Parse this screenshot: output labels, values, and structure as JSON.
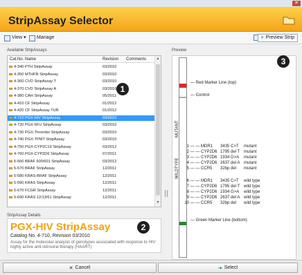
{
  "app": {
    "title": "StripAssay Selector"
  },
  "toolbar": {
    "view_label": "View",
    "manage_label": "Manage",
    "preview_strip_label": "Preview Strip"
  },
  "sections": {
    "available_label": "Available StripAssays",
    "preview_label": "Preview",
    "details_label": "StripAssay Details"
  },
  "list": {
    "columns": [
      "Cat.No.",
      "Name",
      "Revision",
      "Comments"
    ],
    "rows": [
      {
        "cat": "4-340",
        "name": "PTH StripAssay",
        "rev": "03/2010"
      },
      {
        "cat": "4-350",
        "name": "MTHFR StripAssay",
        "rev": "03/2010"
      },
      {
        "cat": "4-360",
        "name": "CVD StripAssay T",
        "rev": "03/2010"
      },
      {
        "cat": "4-370",
        "name": "CVD StripAssay A",
        "rev": "03/2010"
      },
      {
        "cat": "4-380",
        "name": "CAH StripAssay",
        "rev": "05/2011"
      },
      {
        "cat": "4-410",
        "name": "CF StripAssay",
        "rev": "01/2012"
      },
      {
        "cat": "4-420",
        "name": "CF StripAssay TUR",
        "rev": "01/2012"
      },
      {
        "cat": "4-710",
        "name": "PGX-HIV StripAssay",
        "rev": "03/2010"
      },
      {
        "cat": "4-720",
        "name": "PGX-5FU StripAssay",
        "rev": "03/2010"
      },
      {
        "cat": "4-730",
        "name": "PGX-Thrombo StripAssay",
        "rev": "03/2010"
      },
      {
        "cat": "4-740",
        "name": "PGX-TPMT StripAssay",
        "rev": "03/2010"
      },
      {
        "cat": "4-750",
        "name": "PGX-CYP2C19 StripAssay",
        "rev": "03/2012"
      },
      {
        "cat": "4-760",
        "name": "PGX-CYP2D6 StripAssay",
        "rev": "07/2011"
      },
      {
        "cat": "5-560",
        "name": "BRAF 600/601 StripAssay",
        "rev": "03/2012"
      },
      {
        "cat": "5-570",
        "name": "BRAF StripAssay",
        "rev": "12/2011"
      },
      {
        "cat": "5-580",
        "name": "KRAS-BRAF StripAssay",
        "rev": "12/2011"
      },
      {
        "cat": "5-590",
        "name": "KRAS StripAssay",
        "rev": "12/2011"
      },
      {
        "cat": "5-670",
        "name": "FCGR StripAssay",
        "rev": "12/2011"
      },
      {
        "cat": "5-690",
        "name": "KRAS 12/13/61 StripAssay",
        "rev": "12/2011"
      }
    ],
    "selected_index": 7
  },
  "badges": {
    "one": "1",
    "two": "2",
    "three": "3"
  },
  "details": {
    "title": "PGX-HIV StripAssay",
    "catalog": "Catalog No. 4-710, Revision 03/2010",
    "description": "Assay for the molecular analysis of genotypes associated with response to HIV highly active anti-retroviral therapy (HAART)"
  },
  "preview": {
    "red_marker": "Red Marker Line (top)",
    "control": "Control",
    "green_marker": "Green Marker Line (bottom)",
    "mutant_label": "MUTANT",
    "wildtype_label": "WILDTYPE",
    "mutant_rows": [
      {
        "n": "1",
        "gene": "MDR1",
        "variant": "3435 C>T",
        "type": "mutant"
      },
      {
        "n": "2",
        "gene": "CYP2D6",
        "variant": "1795 del T",
        "type": "mutant"
      },
      {
        "n": "3",
        "gene": "CYP2D6",
        "variant": "1934 G>A",
        "type": "mutant"
      },
      {
        "n": "4",
        "gene": "CYP2D6",
        "variant": "2637 del A",
        "type": "mutant"
      },
      {
        "n": "5",
        "gene": "CCR5",
        "variant": "32bp del",
        "type": "mutant"
      }
    ],
    "wildtype_rows": [
      {
        "n": "6",
        "gene": "MDR1",
        "variant": "3435 C>T",
        "type": "wild type"
      },
      {
        "n": "7",
        "gene": "CYP2D6",
        "variant": "1795 del T",
        "type": "wild type"
      },
      {
        "n": "8",
        "gene": "CYP2D6",
        "variant": "1934 G>A",
        "type": "wild type"
      },
      {
        "n": "9",
        "gene": "CYP2D6",
        "variant": "2637 del A",
        "type": "wild type"
      },
      {
        "n": "10",
        "gene": "CCR5",
        "variant": "32bp del",
        "type": "wild type"
      }
    ]
  },
  "buttons": {
    "cancel_label": "Cancel",
    "select_label": "Select"
  },
  "colors": {
    "accent": "#f7a00c",
    "selected": "#3399ff",
    "red_marker": "#dd2a2a",
    "green_marker": "#1f8a2a"
  }
}
